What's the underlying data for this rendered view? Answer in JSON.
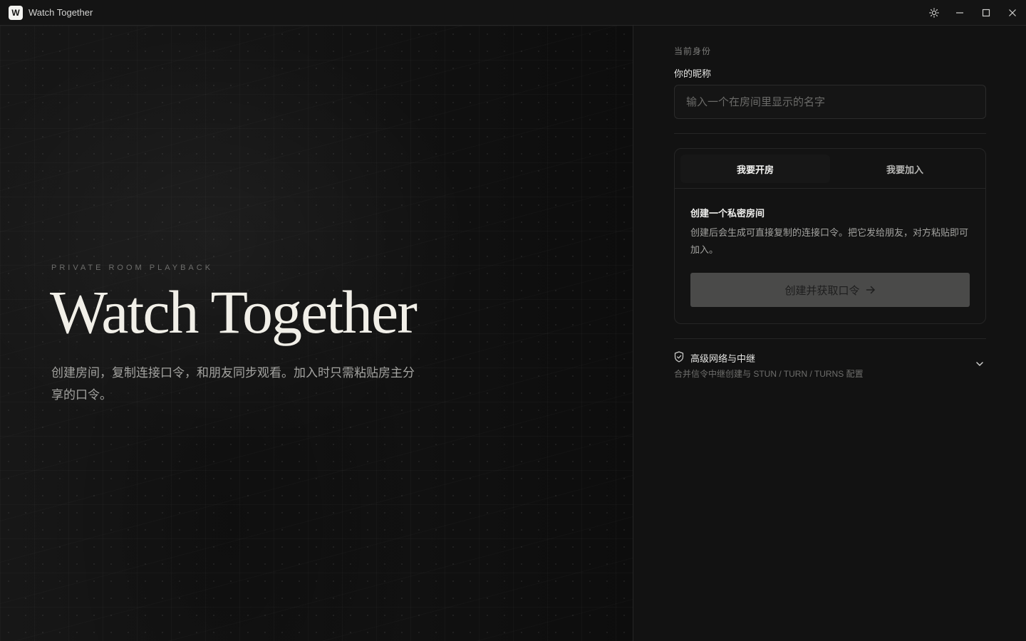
{
  "window": {
    "logo_letter": "W",
    "title": "Watch Together",
    "controls": [
      "theme-toggle",
      "minimize",
      "maximize",
      "close"
    ]
  },
  "hero": {
    "eyebrow": "PRIVATE ROOM PLAYBACK",
    "title": "Watch Together",
    "subtitle": "创建房间，复制连接口令，和朋友同步观看。加入时只需粘贴房主分享的口令。"
  },
  "identity": {
    "section_label": "当前身份",
    "nickname_label": "你的昵称",
    "nickname_value": "",
    "nickname_placeholder": "输入一个在房间里显示的名字"
  },
  "room_card": {
    "tabs": [
      {
        "label": "我要开房",
        "active": true
      },
      {
        "label": "我要加入",
        "active": false
      }
    ],
    "title": "创建一个私密房间",
    "description": "创建后会生成可直接复制的连接口令。把它发给朋友，对方粘贴即可加入。",
    "button_label": "创建并获取口令"
  },
  "advanced": {
    "title": "高级网络与中继",
    "subtitle": "合并信令中继创建与 STUN / TURN / TURNS 配置",
    "icon": "shield-check-icon",
    "expanded": false
  },
  "colors": {
    "background": "#111111",
    "accent_button": "#4a4a49",
    "text_primary": "#f1efe8"
  }
}
